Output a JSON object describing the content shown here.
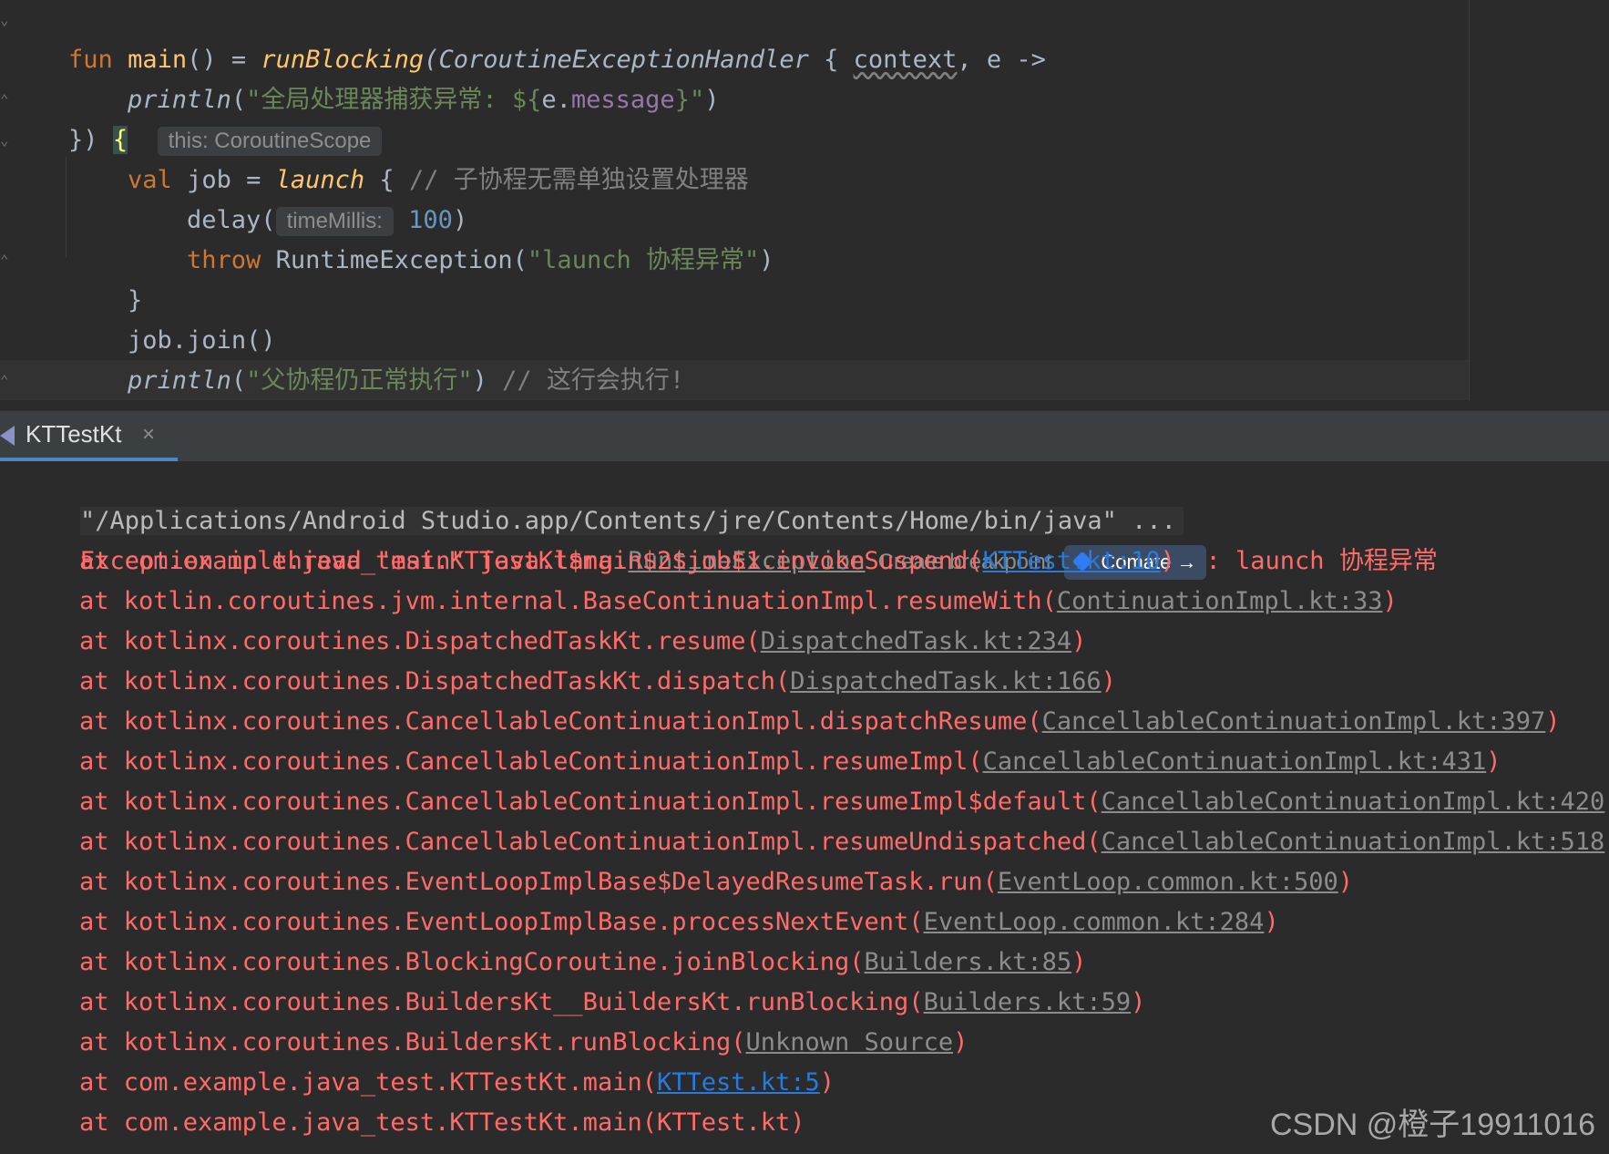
{
  "editor": {
    "line1": {
      "fun": "fun ",
      "main": "main",
      "paren": "() = ",
      "runBlocking": "runBlocking",
      "handler": "(CoroutineExceptionHandler ",
      "brace": "{ ",
      "context": "context",
      "comma": ", e ->"
    },
    "line2": {
      "println": "println",
      "open": "(",
      "str": "\"全局处理器捕获异常: ${",
      "e": "e.",
      "message": "message",
      "close_str": "}\"",
      "close": ")"
    },
    "line3": {
      "close": "})",
      "brace": "{",
      "hint": "this: CoroutineScope"
    },
    "line4": {
      "val": "val ",
      "job": "job = ",
      "launch": "launch",
      "brace": " { ",
      "comment": "// 子协程无需单独设置处理器"
    },
    "line5": {
      "delay": "delay(",
      "hint": "timeMillis:",
      "value": "100",
      "close": ")"
    },
    "line6": {
      "throw": "throw ",
      "ctor": "RuntimeException(",
      "str": "\"launch 协程异常\"",
      "close": ")"
    },
    "line7": {
      "brace": "}"
    },
    "line8": {
      "text": "job.join()"
    },
    "line9": {
      "println": "println",
      "open": "(",
      "str": "\"父协程仍正常执行\"",
      "close": ") ",
      "comment": "// 这行会执行!"
    },
    "line10": {
      "brace": "}"
    }
  },
  "run": {
    "tab_label": "KTTestKt",
    "tab_close": "×",
    "command": "\"/Applications/Android Studio.app/Contents/jre/Contents/Home/bin/java\" ...",
    "exception": {
      "prefix": "Exception in thread \"main\" java.lang.",
      "class_link": "RuntimeException",
      "breakpoint_hint": "Create breakpoint",
      "comate_label": "Comate →",
      "suffix": ": launch 协程异常"
    },
    "stack": [
      {
        "text": "at com.example.java_test.KTTestKt$main$2$job$1.invokeSuspend(",
        "link": "KTTest.kt:10",
        "end": ")",
        "style": "blue"
      },
      {
        "text": "at kotlin.coroutines.jvm.internal.BaseContinuationImpl.resumeWith(",
        "link": "ContinuationImpl.kt:33",
        "end": ")",
        "style": "gray"
      },
      {
        "text": "at kotlinx.coroutines.DispatchedTaskKt.resume(",
        "link": "DispatchedTask.kt:234",
        "end": ")",
        "style": "gray"
      },
      {
        "text": "at kotlinx.coroutines.DispatchedTaskKt.dispatch(",
        "link": "DispatchedTask.kt:166",
        "end": ")",
        "style": "gray"
      },
      {
        "text": "at kotlinx.coroutines.CancellableContinuationImpl.dispatchResume(",
        "link": "CancellableContinuationImpl.kt:397",
        "end": ")",
        "style": "gray"
      },
      {
        "text": "at kotlinx.coroutines.CancellableContinuationImpl.resumeImpl(",
        "link": "CancellableContinuationImpl.kt:431",
        "end": ")",
        "style": "gray"
      },
      {
        "text": "at kotlinx.coroutines.CancellableContinuationImpl.resumeImpl$default(",
        "link": "CancellableContinuationImpl.kt:420",
        "end": ")",
        "style": "gray"
      },
      {
        "text": "at kotlinx.coroutines.CancellableContinuationImpl.resumeUndispatched(",
        "link": "CancellableContinuationImpl.kt:518",
        "end": ")",
        "style": "gray"
      },
      {
        "text": "at kotlinx.coroutines.EventLoopImplBase$DelayedResumeTask.run(",
        "link": "EventLoop.common.kt:500",
        "end": ")",
        "style": "gray"
      },
      {
        "text": "at kotlinx.coroutines.EventLoopImplBase.processNextEvent(",
        "link": "EventLoop.common.kt:284",
        "end": ")",
        "style": "gray"
      },
      {
        "text": "at kotlinx.coroutines.BlockingCoroutine.joinBlocking(",
        "link": "Builders.kt:85",
        "end": ")",
        "style": "gray"
      },
      {
        "text": "at kotlinx.coroutines.BuildersKt__BuildersKt.runBlocking(",
        "link": "Builders.kt:59",
        "end": ")",
        "style": "gray"
      },
      {
        "text": "at kotlinx.coroutines.BuildersKt.runBlocking(",
        "link": "Unknown Source",
        "end": ")",
        "style": "gray"
      },
      {
        "text": "at com.example.java_test.KTTestKt.main(",
        "link": "KTTest.kt:5",
        "end": ")",
        "style": "blue"
      },
      {
        "text": "at com.example.java_test.KTTestKt.main(KTTest.kt)",
        "link": "",
        "end": "",
        "style": "none"
      }
    ]
  },
  "watermark": "CSDN @橙子19911016",
  "colors": {
    "background": "#2b2b2b",
    "keyword": "#cc7832",
    "string": "#6a8759",
    "function": "#ffc66d",
    "error": "#ff6b68",
    "link": "#287bde"
  }
}
